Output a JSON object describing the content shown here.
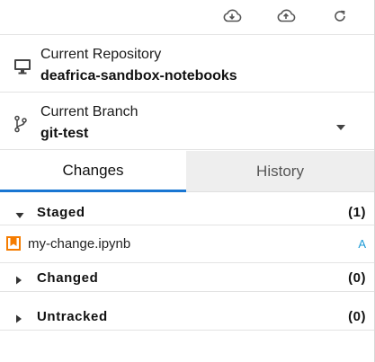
{
  "toolbar": {
    "pull_icon": "cloud-download-icon",
    "push_icon": "cloud-upload-icon",
    "refresh_icon": "refresh-icon"
  },
  "repository": {
    "label": "Current Repository",
    "value": "deafrica-sandbox-notebooks",
    "icon": "desktop-icon"
  },
  "branch": {
    "label": "Current Branch",
    "value": "git-test",
    "icon": "git-branch-icon"
  },
  "tabs": [
    {
      "label": "Changes",
      "active": true
    },
    {
      "label": "History",
      "active": false
    }
  ],
  "sections": {
    "staged": {
      "title": "Staged",
      "count": "(1)",
      "expanded": true,
      "files": [
        {
          "name": "my-change.ipynb",
          "status": "A",
          "icon": "notebook-icon"
        }
      ]
    },
    "changed": {
      "title": "Changed",
      "count": "(0)",
      "expanded": false
    },
    "untracked": {
      "title": "Untracked",
      "count": "(0)",
      "expanded": false
    }
  },
  "colors": {
    "accent": "#1976d2",
    "status_added": "#1c9ad6",
    "notebook_icon": "#f57c00",
    "inactive_tab_bg": "#eeeeee"
  }
}
